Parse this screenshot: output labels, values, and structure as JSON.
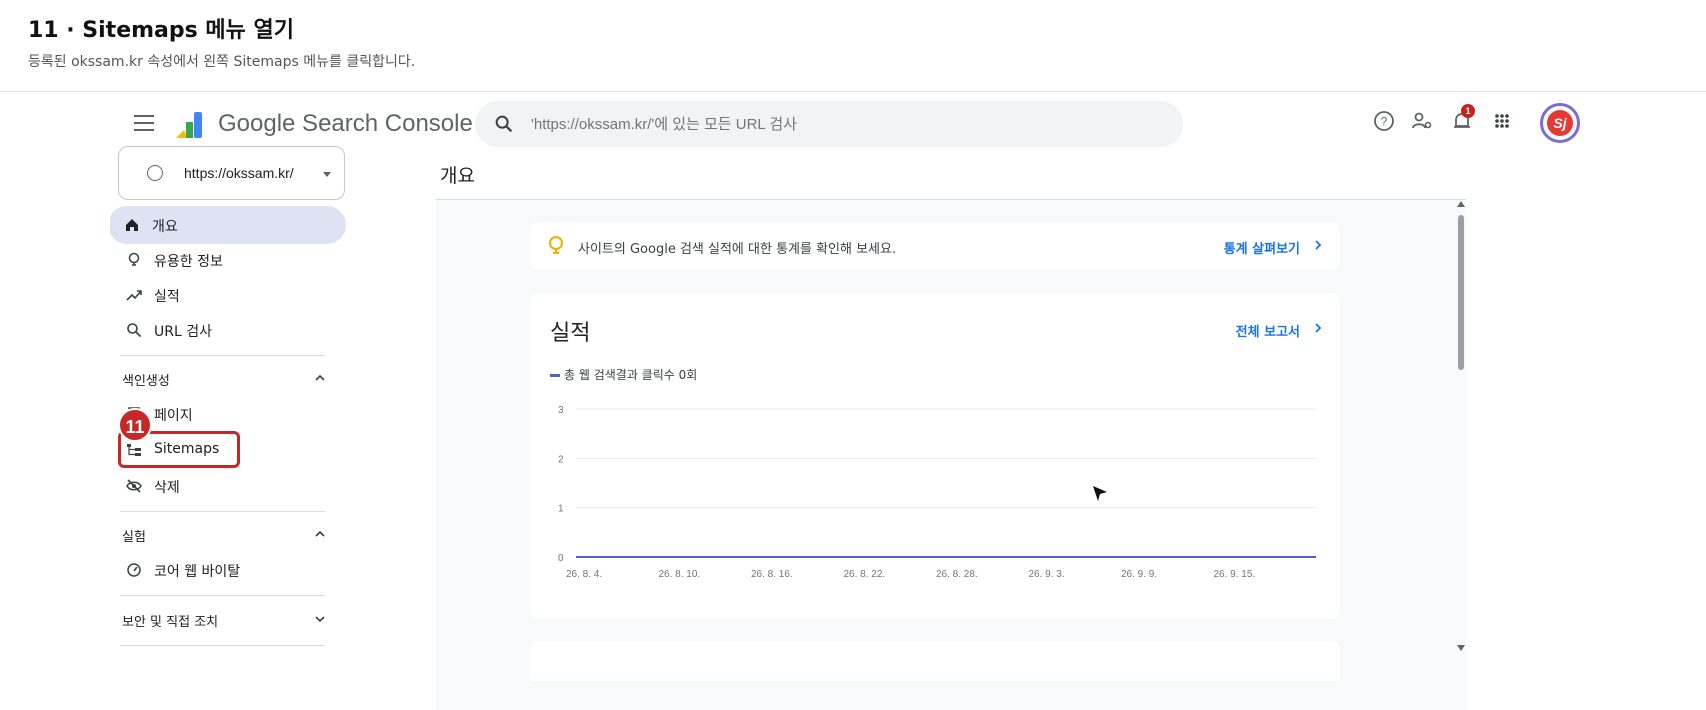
{
  "guide": {
    "title": "11 · Sitemaps 메뉴 열기",
    "subtitle": "등록된 okssam.kr 속성에서 왼쪽 Sitemaps 메뉴를 클릭합니다."
  },
  "topbar": {
    "logo_text": "Google Search Console",
    "search_placeholder": "'https://okssam.kr/'에 있는 모든 URL 검사",
    "notification_count": "1",
    "avatar_initials": "Sj"
  },
  "sidebar": {
    "property": "https://okssam.kr/",
    "items": [
      {
        "label": "개요",
        "icon": "home-icon",
        "active": true
      },
      {
        "label": "유용한 정보",
        "icon": "lightbulb-icon"
      },
      {
        "label": "실적",
        "icon": "trending-up-icon"
      },
      {
        "label": "URL 검사",
        "icon": "search-icon"
      }
    ],
    "sections": [
      {
        "label": "색인생성",
        "expanded": true,
        "items": [
          {
            "label": "페이지",
            "icon": "pages-icon"
          },
          {
            "label": "Sitemaps",
            "icon": "sitemap-icon",
            "highlighted": true
          },
          {
            "label": "삭제",
            "icon": "eye-off-icon"
          }
        ]
      },
      {
        "label": "실험",
        "expanded": true,
        "items": [
          {
            "label": "코어 웹 바이탈",
            "icon": "gauge-icon"
          }
        ]
      },
      {
        "label": "보안 및 직접 조치",
        "expanded": false,
        "items": []
      }
    ],
    "step_badge": "11"
  },
  "main": {
    "page_title": "개요",
    "tip": {
      "text": "사이트의 Google 검색 실적에 대한 통계를 확인해 보세요.",
      "link": "통계 살펴보기"
    },
    "performance": {
      "title": "실적",
      "link": "전체 보고서"
    }
  },
  "colors": {
    "accent": "#1a73e8",
    "series": "#4f63c8",
    "active_nav": "#dde3f3",
    "highlight": "#c62828"
  },
  "chart_data": {
    "type": "line",
    "title": "",
    "series": [
      {
        "name": "총 웹 검색결과 클릭수 0회",
        "values": [
          0,
          0,
          0,
          0,
          0,
          0,
          0,
          0
        ]
      }
    ],
    "categories": [
      "26. 8. 4.",
      "26. 8. 10.",
      "26. 8. 16.",
      "26. 8. 22.",
      "26. 8. 28.",
      "26. 9. 3.",
      "26. 9. 9.",
      "26. 9. 15."
    ],
    "yticks": [
      "0",
      "1",
      "2",
      "3"
    ],
    "ylim": [
      0,
      3
    ],
    "grid": true,
    "legend": "top-left"
  }
}
